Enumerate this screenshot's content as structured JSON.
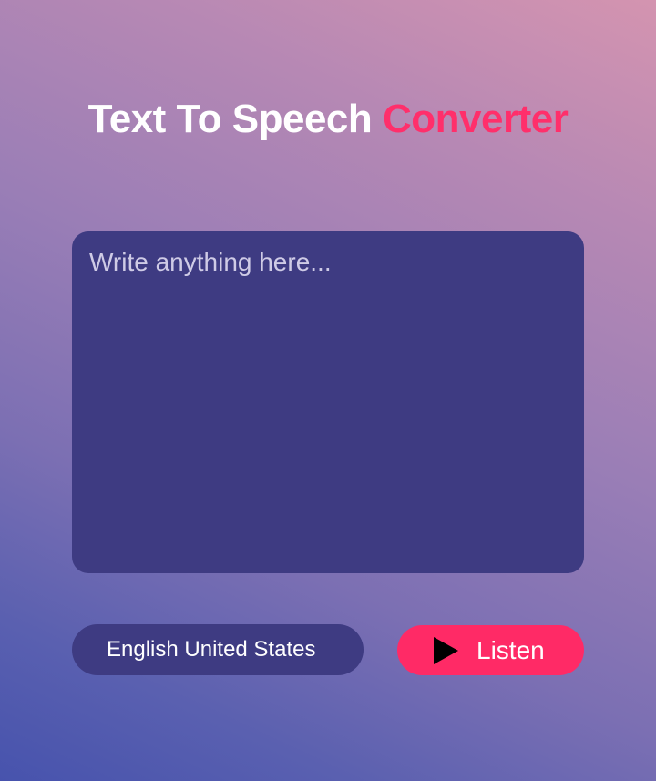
{
  "header": {
    "title_main": "Text To Speech ",
    "title_accent": "Converter"
  },
  "editor": {
    "placeholder": "Write anything here...",
    "value": ""
  },
  "language": {
    "selected": "English United States"
  },
  "listen_button": {
    "label": "Listen",
    "icon": "play-icon"
  },
  "colors": {
    "accent": "#ff2a66",
    "panel": "#3e3b82",
    "text": "#ffffff"
  }
}
